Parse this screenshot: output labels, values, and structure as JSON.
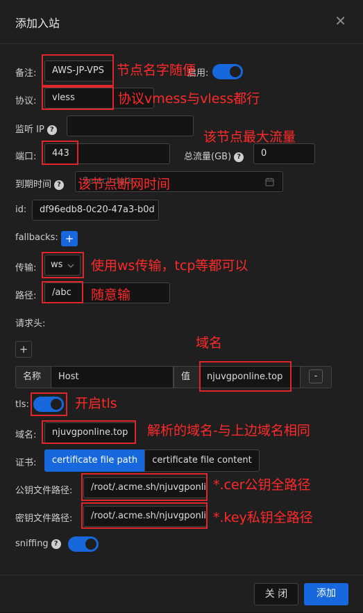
{
  "header": {
    "title": "添加入站",
    "close_glyph": "✕"
  },
  "fields": {
    "remark_label": "备注:",
    "remark_value": "AWS-JP-VPS",
    "enable_label": "启用:",
    "protocol_label": "协议:",
    "protocol_value": "vless",
    "listen_ip_label": "监听 IP",
    "port_label": "端口:",
    "port_value": "443",
    "total_traffic_label": "总流量(GB)",
    "total_traffic_value": "0",
    "expiry_label": "到期时间",
    "expiry_placeholder": "Select date",
    "id_label": "id:",
    "id_value": "df96edb8-0c20-47a3-b0d",
    "fallbacks_label": "fallbacks:",
    "add_glyph": "+",
    "transport_label": "传输:",
    "transport_value": "ws",
    "path_label": "路径:",
    "path_value": "/abc",
    "request_header_label": "请求头:",
    "header_name_label": "名称",
    "header_name_value": "Host",
    "header_value_label": "值",
    "header_value_value": "njuvgponline.top",
    "remove_glyph": "-",
    "tls_label": "tls:",
    "domain_label": "域名:",
    "domain_value": "njuvgponline.top",
    "cert_label": "证书:",
    "cert_tab_path": "certificate file path",
    "cert_tab_content": "certificate file content",
    "pubkey_label": "公钥文件路径:",
    "pubkey_value": "/root/.acme.sh/njuvgponli",
    "privkey_label": "密钥文件路径:",
    "privkey_value": "/root/.acme.sh/njuvgponli",
    "sniffing_label": "sniffing"
  },
  "annotations": {
    "remark": "节点名字随便",
    "protocol": "协议vmess与vless都行",
    "traffic": "该节点最大流量",
    "expiry": "该节点断网时间",
    "transport": "使用ws传输，tcp等都可以",
    "path": "随意输",
    "domain_top": "域名",
    "tls": "开启tls",
    "domain": "解析的域名-与上边域名相同",
    "cer": "*.cer公钥全路径",
    "key": "*.key私钥全路径"
  },
  "footer": {
    "close_label": "关 闭",
    "add_label": "添加"
  },
  "colors": {
    "accent": "#1668dc",
    "annotation": "#ff2a2a",
    "background": "#1f1f1f"
  }
}
